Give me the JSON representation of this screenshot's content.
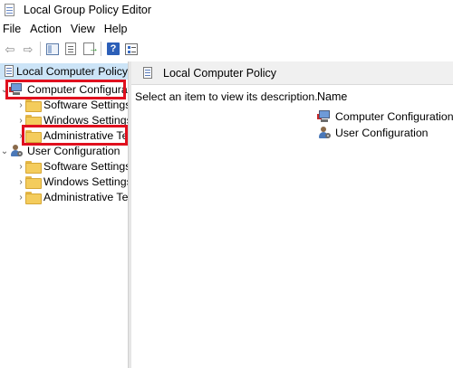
{
  "window": {
    "title": "Local Group Policy Editor"
  },
  "menu": [
    "File",
    "Action",
    "View",
    "Help"
  ],
  "toolbar": {
    "buttons": [
      "back-icon",
      "forward-icon",
      "show-hide-tree-icon",
      "properties-list-icon",
      "export-list-icon",
      "help-icon",
      "properties-icon"
    ]
  },
  "tree": {
    "root": "Local Computer Policy",
    "computer": {
      "label": "Computer Configuration",
      "children": [
        "Software Settings",
        "Windows Settings",
        "Administrative Templates"
      ]
    },
    "user": {
      "label": "User Configuration",
      "children": [
        "Software Settings",
        "Windows Settings",
        "Administrative Templates"
      ]
    }
  },
  "content": {
    "header": "Local Computer Policy",
    "description": "Select an item to view its description.",
    "column_name": "Name",
    "items": [
      "Computer Configuration",
      "User Configuration"
    ]
  },
  "colors": {
    "selection": "#cce4f7",
    "highlight_box": "#e0101e",
    "folder": "#f4cc5c"
  }
}
